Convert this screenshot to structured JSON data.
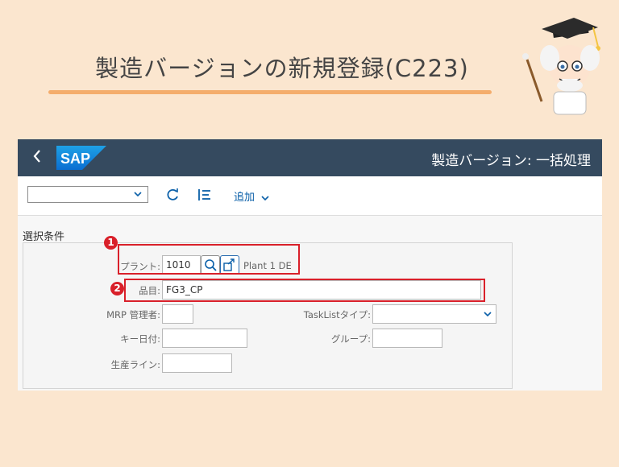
{
  "slide": {
    "title": "製造バージョンの新規登録(C223)"
  },
  "app": {
    "logo_text": "SAP",
    "title": "製造バージョン: 一括処理",
    "back_icon": "chevron-left-icon"
  },
  "toolbar": {
    "variant_value": "",
    "refresh_icon": "refresh-icon",
    "settings_icon": "list-settings-icon",
    "add_label": "追加"
  },
  "selection": {
    "section_title": "選択条件",
    "plant_label": "プラント:",
    "plant_value": "1010",
    "plant_desc": "Plant 1 DE",
    "material_label": "品目:",
    "material_value": "FG3_CP",
    "mrp_label": "MRP 管理者:",
    "mrp_value": "",
    "tasklist_label": "TaskListタイプ:",
    "tasklist_value": "",
    "keydate_label": "キー日付:",
    "keydate_value": "",
    "group_label": "グループ:",
    "group_value": "",
    "line_label": "生産ライン:",
    "line_value": ""
  },
  "annotations": {
    "one": "1",
    "two": "2"
  },
  "colors": {
    "shell": "#354a5f",
    "accent": "#0a6ed1",
    "annotation": "#d9202a",
    "background": "#fbe6cf"
  }
}
